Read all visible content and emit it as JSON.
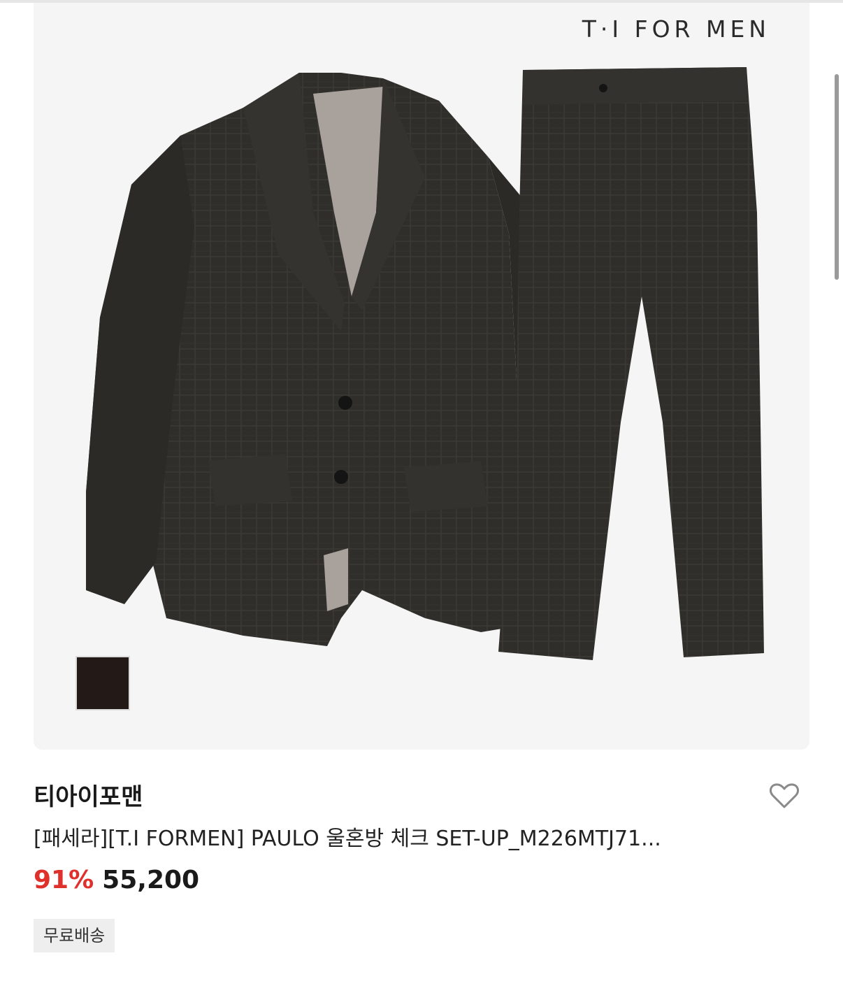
{
  "product": {
    "image_logo_text": "T·I FOR MEN",
    "swatch_color": "#231a18",
    "brand": "티아이포맨",
    "title": "[패세라][T.I FORMEN] PAULO 울혼방 체크 SET-UP_M226MTJ71...",
    "discount": "91%",
    "price": "55,200",
    "badge": "무료배송",
    "wishlist_icon": "heart-outline-icon"
  },
  "colors": {
    "discount": "#e0302b",
    "text": "#1a1a1a",
    "badge_bg": "#eeeeee",
    "image_bg": "#f5f5f5"
  }
}
